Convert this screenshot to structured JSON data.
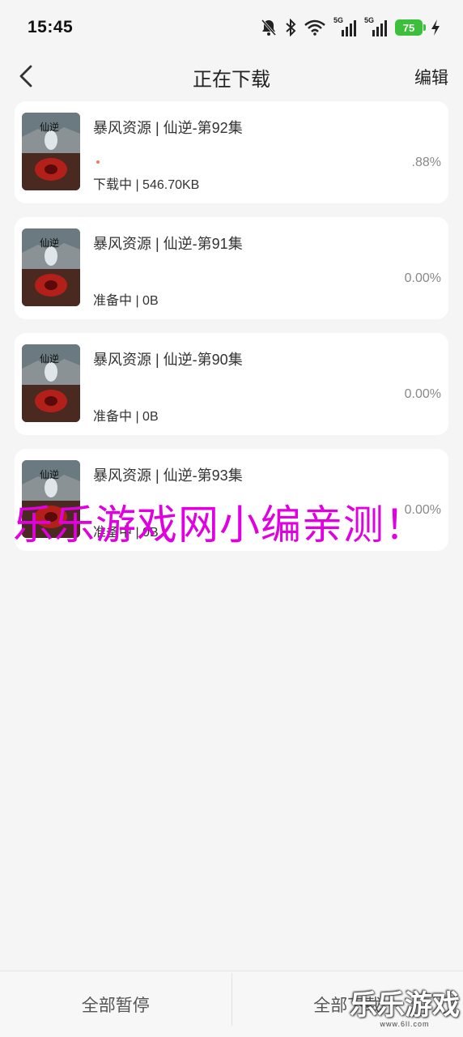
{
  "status_bar": {
    "time": "15:45",
    "icons": [
      "bell-off-icon",
      "bluetooth-icon",
      "wifi-icon",
      "signal-5g-icon",
      "signal-5g-icon",
      "battery-icon",
      "charging-icon"
    ],
    "signal_1_label": "5G",
    "signal_2_label": "5G",
    "battery_level": "75",
    "battery_color": "#3cc03c"
  },
  "nav": {
    "back_icon": "chevron-left-icon",
    "title": "正在下载",
    "edit_label": "编辑"
  },
  "downloads": [
    {
      "title": "暴风资源 | 仙逆-第92集",
      "status": "下载中 | 546.70KB",
      "percent": ".88%",
      "progress": 0.0088
    },
    {
      "title": "暴风资源 | 仙逆-第91集",
      "status": "准备中 | 0B",
      "percent": "0.00%",
      "progress": 0
    },
    {
      "title": "暴风资源 | 仙逆-第90集",
      "status": "准备中 | 0B",
      "percent": "0.00%",
      "progress": 0
    },
    {
      "title": "暴风资源 | 仙逆-第93集",
      "status": "准备中 | 0B",
      "percent": "0.00%",
      "progress": 0
    }
  ],
  "watermark": "乐乐游戏网小编亲测！",
  "bottom_bar": {
    "pause_all_label": "全部暂停",
    "download_all_label": "全部下载"
  },
  "corner_logo": {
    "text": "乐乐游戏",
    "url": "www.6ll.com"
  },
  "colors": {
    "background": "#f5f5f5",
    "card": "#ffffff",
    "progress_accent": "#f27a5a",
    "watermark": "#e000e0"
  }
}
